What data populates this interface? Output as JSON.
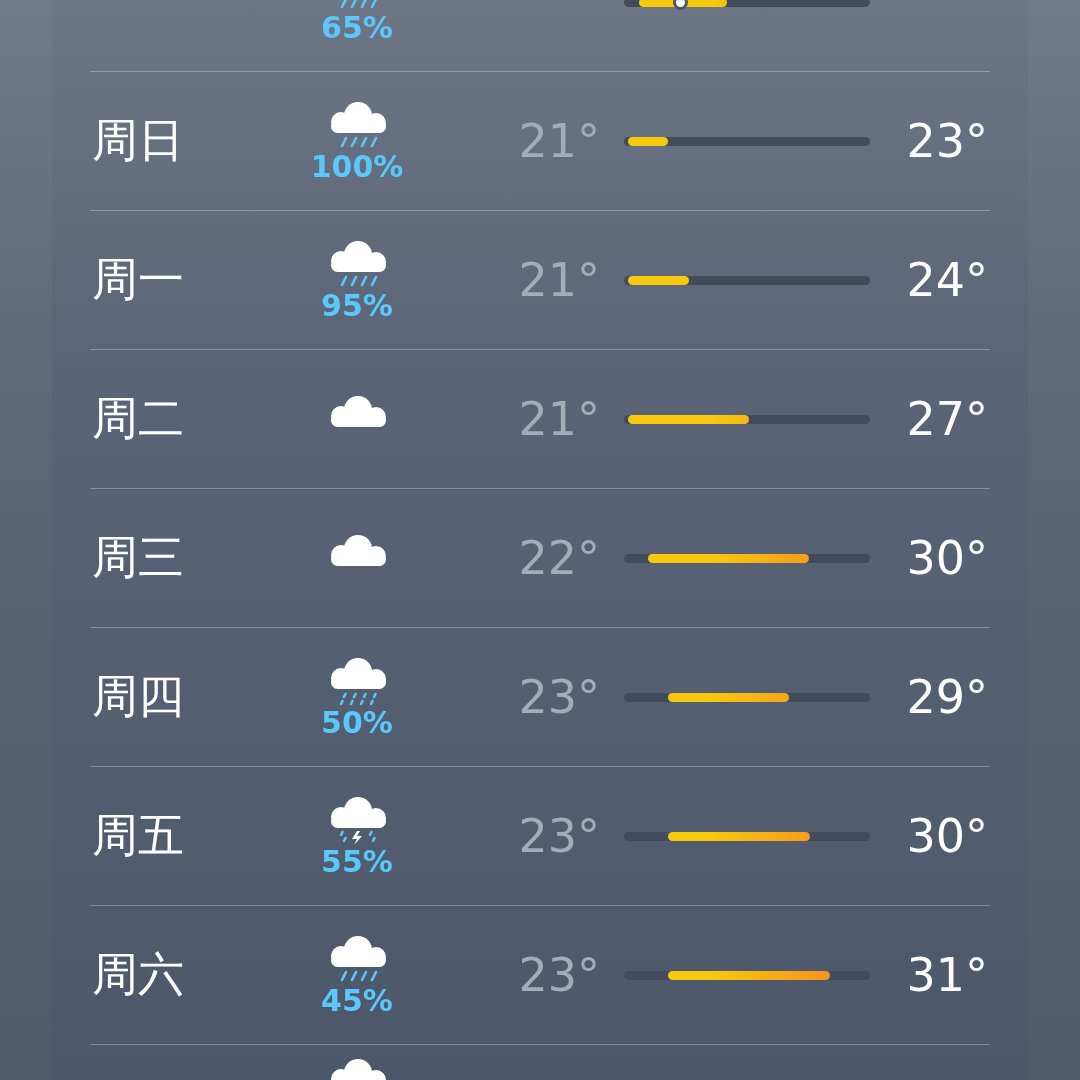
{
  "days": [
    {
      "kind": "rain",
      "chance": "65%",
      "level": 0.22
    },
    {
      "day": "周日",
      "kind": "rain",
      "chance": "100%",
      "low": "21°",
      "high": "23°"
    },
    {
      "day": "周一",
      "kind": "rain",
      "chance": "95%",
      "low": "21°",
      "high": "24°"
    },
    {
      "day": "周二",
      "kind": "cloud",
      "low": "21°",
      "high": "27°"
    },
    {
      "day": "周三",
      "kind": "cloud",
      "low": "22°",
      "high": "30°"
    },
    {
      "day": "周四",
      "kind": "drizzle",
      "chance": "50%",
      "low": "23°",
      "high": "29°"
    },
    {
      "day": "周五",
      "kind": "thunder",
      "chance": "55%",
      "low": "23°",
      "high": "30°"
    },
    {
      "day": "周六",
      "kind": "rain",
      "chance": "45%",
      "low": "23°",
      "high": "31°"
    },
    {
      "kind": "cloud"
    }
  ]
}
